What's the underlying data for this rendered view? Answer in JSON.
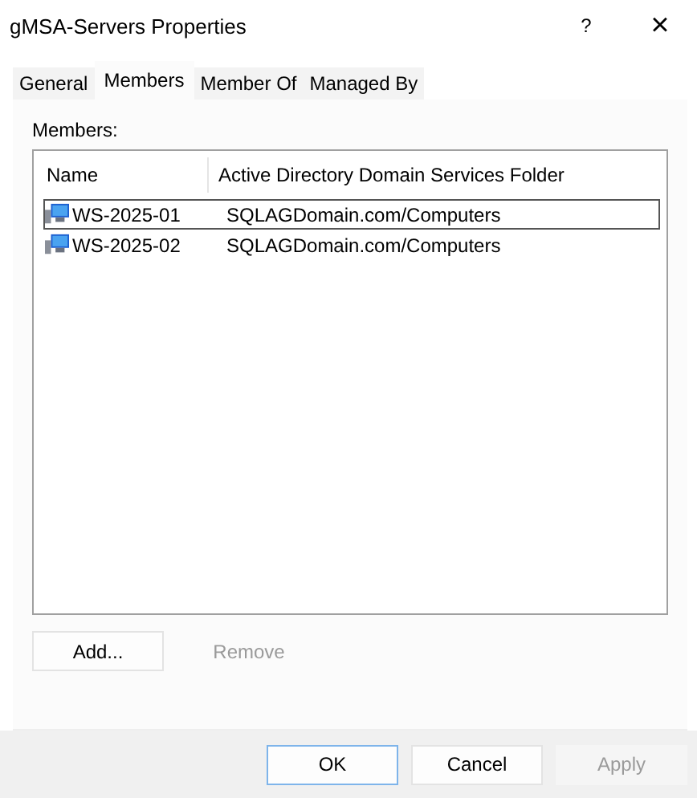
{
  "window": {
    "title": "gMSA-Servers Properties",
    "help": "?",
    "close": "×"
  },
  "tabs": [
    {
      "label": "General",
      "selected": false
    },
    {
      "label": "Members",
      "selected": true
    },
    {
      "label": "Member Of",
      "selected": false
    },
    {
      "label": "Managed By",
      "selected": false
    }
  ],
  "members_label": "Members:",
  "table": {
    "columns": [
      "Name",
      "Active Directory Domain Services Folder"
    ],
    "rows": [
      {
        "name": "WS-2025-01",
        "folder": "SQLAGDomain.com/Computers",
        "focused": true
      },
      {
        "name": "WS-2025-02",
        "folder": "SQLAGDomain.com/Computers",
        "focused": false
      }
    ]
  },
  "list_buttons": [
    {
      "label": "Add...",
      "disabled": false
    },
    {
      "label": "Remove",
      "disabled": true
    }
  ],
  "dialog_buttons": [
    {
      "label": "OK",
      "disabled": false,
      "default": true
    },
    {
      "label": "Cancel",
      "disabled": false,
      "default": false
    },
    {
      "label": "Apply",
      "disabled": true,
      "default": false
    }
  ]
}
